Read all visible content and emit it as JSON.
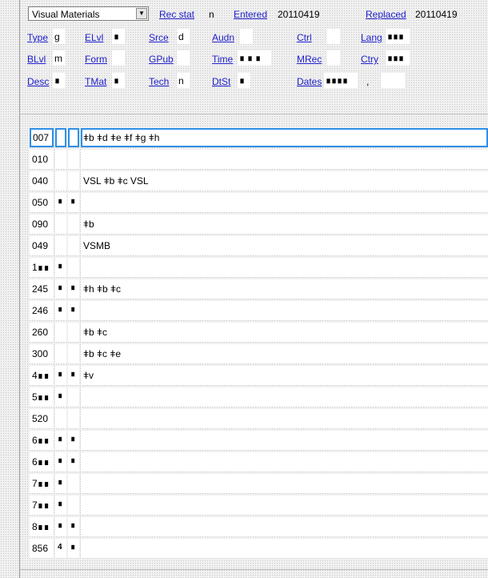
{
  "header": {
    "material_select": "Visual Materials",
    "rec_stat_label": "Rec stat",
    "rec_stat_value": "n",
    "entered_label": "Entered",
    "entered_value": "20110419",
    "replaced_label": "Replaced",
    "replaced_value": "20110419"
  },
  "fixed": {
    "type": {
      "label": "Type",
      "value": "g"
    },
    "elvl": {
      "label": "ELvl",
      "value": "∎"
    },
    "srce": {
      "label": "Srce",
      "value": "d"
    },
    "audn": {
      "label": "Audn",
      "value": ""
    },
    "ctrl": {
      "label": "Ctrl",
      "value": ""
    },
    "lang": {
      "label": "Lang",
      "value": "∎∎∎"
    },
    "blvl": {
      "label": "BLvl",
      "value": "m"
    },
    "form": {
      "label": "Form",
      "value": ""
    },
    "gpub": {
      "label": "GPub",
      "value": ""
    },
    "time": {
      "label": "Time",
      "value": "∎ ∎ ∎"
    },
    "mrec": {
      "label": "MRec",
      "value": ""
    },
    "ctry": {
      "label": "Ctry",
      "value": "∎∎∎"
    },
    "desc": {
      "label": "Desc",
      "value": "∎"
    },
    "tmat": {
      "label": "TMat",
      "value": "∎"
    },
    "tech": {
      "label": "Tech",
      "value": "n"
    },
    "dtst": {
      "label": "DtSt",
      "value": "∎"
    },
    "dates": {
      "label": "Dates",
      "value": "∎∎∎∎",
      "sep": ",",
      "value2": ""
    }
  },
  "fields": [
    {
      "tag": "007",
      "i1": "",
      "i2": "",
      "data": "ǂb ǂd ǂe ǂf ǂg ǂh"
    },
    {
      "tag": "010",
      "i1": "",
      "i2": "",
      "data": ""
    },
    {
      "tag": "040",
      "i1": "",
      "i2": "",
      "data": "VSL ǂb ǂc VSL"
    },
    {
      "tag": "050",
      "i1": "∎",
      "i2": "∎",
      "data": ""
    },
    {
      "tag": "090",
      "i1": "",
      "i2": "",
      "data": "ǂb"
    },
    {
      "tag": "049",
      "i1": "",
      "i2": "",
      "data": "VSMB"
    },
    {
      "tag": "1∎∎",
      "i1": "∎",
      "i2": "",
      "data": ""
    },
    {
      "tag": "245",
      "i1": "∎",
      "i2": "∎",
      "data": "ǂh ǂb ǂc"
    },
    {
      "tag": "246",
      "i1": "∎",
      "i2": "∎",
      "data": ""
    },
    {
      "tag": "260",
      "i1": "",
      "i2": "",
      "data": "ǂb ǂc"
    },
    {
      "tag": "300",
      "i1": "",
      "i2": "",
      "data": "ǂb ǂc ǂe"
    },
    {
      "tag": "4∎∎",
      "i1": "∎",
      "i2": "∎",
      "data": "ǂv"
    },
    {
      "tag": "5∎∎",
      "i1": "∎",
      "i2": "",
      "data": ""
    },
    {
      "tag": "520",
      "i1": "",
      "i2": "",
      "data": ""
    },
    {
      "tag": "6∎∎",
      "i1": "∎",
      "i2": "∎",
      "data": ""
    },
    {
      "tag": "6∎∎",
      "i1": "∎",
      "i2": "∎",
      "data": ""
    },
    {
      "tag": "7∎∎",
      "i1": "∎",
      "i2": "",
      "data": ""
    },
    {
      "tag": "7∎∎",
      "i1": "∎",
      "i2": "",
      "data": ""
    },
    {
      "tag": "8∎∎",
      "i1": "∎",
      "i2": "∎",
      "data": ""
    },
    {
      "tag": "856",
      "i1": "4",
      "i2": "∎",
      "data": ""
    }
  ]
}
